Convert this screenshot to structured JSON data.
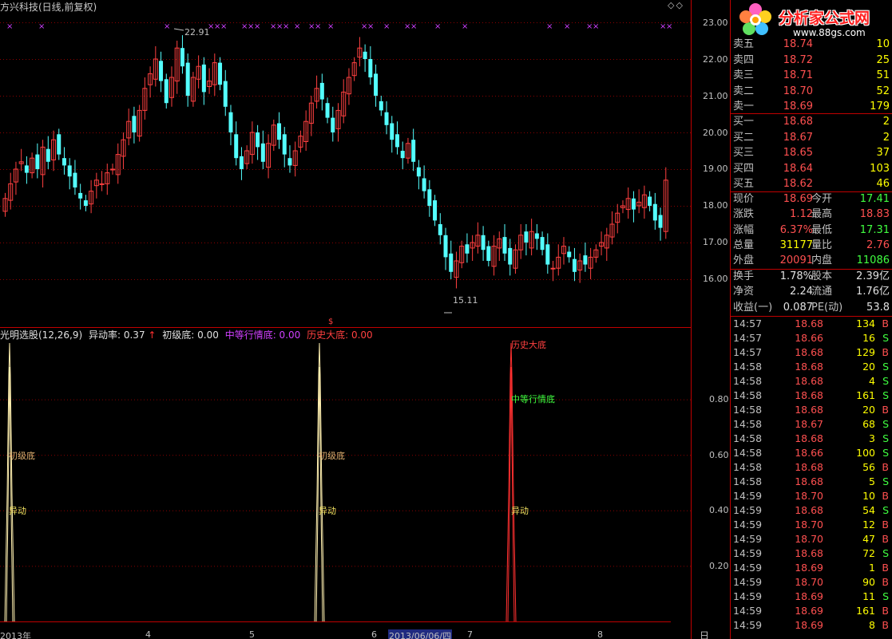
{
  "window": {
    "title": "方兴科技(日线,前复权)",
    "controls": "◇◇",
    "period": "日线"
  },
  "main_chart": {
    "high_marker": "22.91",
    "low_marker": "15.11",
    "price_axis": [
      "23.00",
      "22.00",
      "21.00",
      "20.00",
      "19.00",
      "18.00",
      "17.00",
      "16.00"
    ],
    "event_marker": "$",
    "dates": [
      {
        "label": "2013年"
      },
      {
        "label": "4"
      },
      {
        "label": "5"
      },
      {
        "label": "6"
      },
      {
        "label": "7"
      },
      {
        "label": "8"
      }
    ],
    "current_date": "2013/06/06/四"
  },
  "indicator": {
    "name": "光明选股(12,26,9)",
    "items": [
      {
        "label": "异动率: 0.37",
        "color": "#e0e0e0"
      },
      {
        "label": "↑",
        "color": "#ff3030"
      },
      {
        "label": "初级底: 0.00",
        "color": "#e0e0e0"
      },
      {
        "label": "中等行情底: 0.00",
        "color": "#d040ff"
      },
      {
        "label": "历史大底: 0.00",
        "color": "#ff4040"
      }
    ],
    "axis": [
      "0.80",
      "0.60",
      "0.40",
      "0.20"
    ],
    "annotations": {
      "chuji": "初级底",
      "yidong": "异动",
      "zhongdeng": "中等行情底",
      "lishi": "历史大底"
    }
  },
  "quote": {
    "logo_text": "分析家公式网",
    "logo_url": "www.88gs.com",
    "asks": [
      {
        "label": "卖五",
        "price": "18.74",
        "vol": "10"
      },
      {
        "label": "卖四",
        "price": "18.72",
        "vol": "25"
      },
      {
        "label": "卖三",
        "price": "18.71",
        "vol": "51"
      },
      {
        "label": "卖二",
        "price": "18.70",
        "vol": "52"
      },
      {
        "label": "卖一",
        "price": "18.69",
        "vol": "179"
      }
    ],
    "bids": [
      {
        "label": "买一",
        "price": "18.68",
        "vol": "2"
      },
      {
        "label": "买二",
        "price": "18.67",
        "vol": "2"
      },
      {
        "label": "买三",
        "price": "18.65",
        "vol": "37"
      },
      {
        "label": "买四",
        "price": "18.64",
        "vol": "103"
      },
      {
        "label": "买五",
        "price": "18.62",
        "vol": "46"
      }
    ],
    "stats": [
      {
        "l1": "现价",
        "v1": "18.69",
        "c1": "red",
        "l2": "今开",
        "v2": "17.41",
        "c2": "green"
      },
      {
        "l1": "涨跌",
        "v1": "1.12",
        "c1": "red",
        "l2": "最高",
        "v2": "18.83",
        "c2": "red"
      },
      {
        "l1": "涨幅",
        "v1": "6.37%",
        "c1": "red",
        "l2": "最低",
        "v2": "17.31",
        "c2": "green"
      },
      {
        "l1": "总量",
        "v1": "31177",
        "c1": "yellow",
        "l2": "量比",
        "v2": "2.76",
        "c2": "red"
      },
      {
        "l1": "外盘",
        "v1": "20091",
        "c1": "red",
        "l2": "内盘",
        "v2": "11086",
        "c2": "green"
      }
    ],
    "stats2": [
      {
        "l1": "换手",
        "v1": "1.78%",
        "c1": "white",
        "l2": "股本",
        "v2": "2.39亿",
        "c2": "white"
      },
      {
        "l1": "净资",
        "v1": "2.24",
        "c1": "white",
        "l2": "流通",
        "v2": "1.76亿",
        "c2": "white"
      },
      {
        "l1": "收益(一)",
        "v1": "0.087",
        "c1": "white",
        "l2": "PE(动)",
        "v2": "53.8",
        "c2": "white"
      }
    ],
    "ticks": [
      {
        "t": "14:57",
        "p": "18.68",
        "v": "134",
        "s": "B"
      },
      {
        "t": "14:57",
        "p": "18.66",
        "v": "16",
        "s": "S"
      },
      {
        "t": "14:57",
        "p": "18.68",
        "v": "129",
        "s": "B"
      },
      {
        "t": "14:58",
        "p": "18.68",
        "v": "20",
        "s": "S"
      },
      {
        "t": "14:58",
        "p": "18.68",
        "v": "4",
        "s": "S"
      },
      {
        "t": "14:58",
        "p": "18.68",
        "v": "161",
        "s": "S"
      },
      {
        "t": "14:58",
        "p": "18.68",
        "v": "20",
        "s": "B"
      },
      {
        "t": "14:58",
        "p": "18.67",
        "v": "68",
        "s": "S"
      },
      {
        "t": "14:58",
        "p": "18.68",
        "v": "3",
        "s": "S"
      },
      {
        "t": "14:58",
        "p": "18.66",
        "v": "100",
        "s": "S"
      },
      {
        "t": "14:58",
        "p": "18.68",
        "v": "56",
        "s": "B"
      },
      {
        "t": "14:58",
        "p": "18.68",
        "v": "5",
        "s": "S"
      },
      {
        "t": "14:59",
        "p": "18.70",
        "v": "10",
        "s": "B"
      },
      {
        "t": "14:59",
        "p": "18.68",
        "v": "54",
        "s": "S"
      },
      {
        "t": "14:59",
        "p": "18.70",
        "v": "12",
        "s": "B"
      },
      {
        "t": "14:59",
        "p": "18.70",
        "v": "47",
        "s": "B"
      },
      {
        "t": "14:59",
        "p": "18.68",
        "v": "72",
        "s": "S"
      },
      {
        "t": "14:59",
        "p": "18.69",
        "v": "1",
        "s": "B"
      },
      {
        "t": "14:59",
        "p": "18.70",
        "v": "90",
        "s": "B"
      },
      {
        "t": "14:59",
        "p": "18.69",
        "v": "11",
        "s": "S"
      },
      {
        "t": "14:59",
        "p": "18.69",
        "v": "161",
        "s": "B"
      },
      {
        "t": "14:59",
        "p": "18.69",
        "v": "8",
        "s": "B"
      }
    ]
  },
  "colors": {
    "up": "#ff4040",
    "down": "#54ffff",
    "grid": "#8b0000",
    "marker": "#d040ff",
    "border": "#c00000"
  }
}
